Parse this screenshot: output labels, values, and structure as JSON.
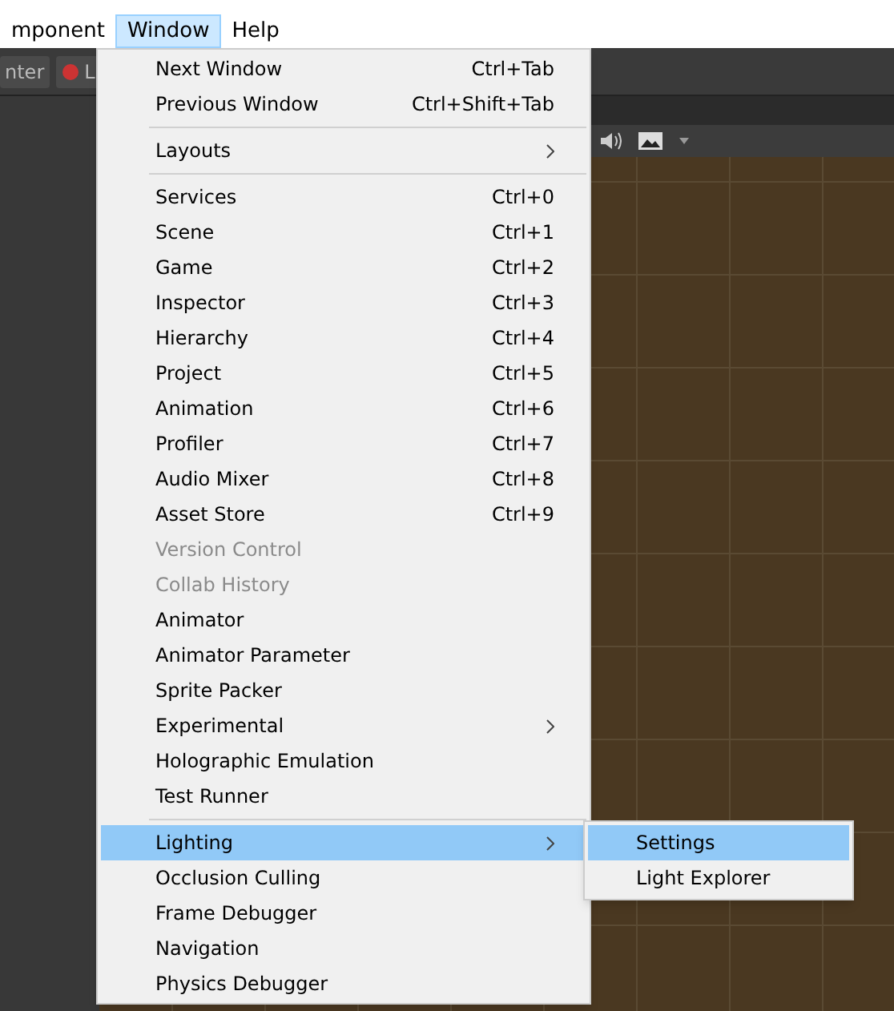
{
  "menu_bar": [
    {
      "label": "mponent",
      "selected": false
    },
    {
      "label": "Window",
      "selected": true
    },
    {
      "label": "Help",
      "selected": false
    }
  ],
  "toolbar": {
    "buttons": [
      "nter",
      "L"
    ]
  },
  "window_menu": {
    "groups": [
      [
        {
          "label": "Next Window",
          "shortcut": "Ctrl+Tab",
          "disabled": false,
          "selected": false
        },
        {
          "label": "Previous Window",
          "shortcut": "Ctrl+Shift+Tab",
          "disabled": false,
          "selected": false
        }
      ],
      [
        {
          "label": "Layouts",
          "has_submenu": true,
          "disabled": false,
          "selected": false
        }
      ],
      [
        {
          "label": "Services",
          "shortcut": "Ctrl+0",
          "disabled": false,
          "selected": false
        },
        {
          "label": "Scene",
          "shortcut": "Ctrl+1",
          "disabled": false,
          "selected": false
        },
        {
          "label": "Game",
          "shortcut": "Ctrl+2",
          "disabled": false,
          "selected": false
        },
        {
          "label": "Inspector",
          "shortcut": "Ctrl+3",
          "disabled": false,
          "selected": false
        },
        {
          "label": "Hierarchy",
          "shortcut": "Ctrl+4",
          "disabled": false,
          "selected": false
        },
        {
          "label": "Project",
          "shortcut": "Ctrl+5",
          "disabled": false,
          "selected": false
        },
        {
          "label": "Animation",
          "shortcut": "Ctrl+6",
          "disabled": false,
          "selected": false
        },
        {
          "label": "Profiler",
          "shortcut": "Ctrl+7",
          "disabled": false,
          "selected": false
        },
        {
          "label": "Audio Mixer",
          "shortcut": "Ctrl+8",
          "disabled": false,
          "selected": false
        },
        {
          "label": "Asset Store",
          "shortcut": "Ctrl+9",
          "disabled": false,
          "selected": false
        },
        {
          "label": "Version Control",
          "disabled": true,
          "selected": false
        },
        {
          "label": "Collab History",
          "disabled": true,
          "selected": false
        },
        {
          "label": "Animator",
          "disabled": false,
          "selected": false
        },
        {
          "label": "Animator Parameter",
          "disabled": false,
          "selected": false
        },
        {
          "label": "Sprite Packer",
          "disabled": false,
          "selected": false
        },
        {
          "label": "Experimental",
          "has_submenu": true,
          "disabled": false,
          "selected": false
        },
        {
          "label": "Holographic Emulation",
          "disabled": false,
          "selected": false
        },
        {
          "label": "Test Runner",
          "disabled": false,
          "selected": false
        }
      ],
      [
        {
          "label": "Lighting",
          "has_submenu": true,
          "disabled": false,
          "selected": true,
          "children": [
            {
              "label": "Settings",
              "selected": true
            },
            {
              "label": "Light Explorer",
              "selected": false
            }
          ]
        },
        {
          "label": "Occlusion Culling",
          "disabled": false,
          "selected": false
        },
        {
          "label": "Frame Debugger",
          "disabled": false,
          "selected": false
        },
        {
          "label": "Navigation",
          "disabled": false,
          "selected": false
        },
        {
          "label": "Physics Debugger",
          "disabled": false,
          "selected": false
        }
      ]
    ]
  }
}
